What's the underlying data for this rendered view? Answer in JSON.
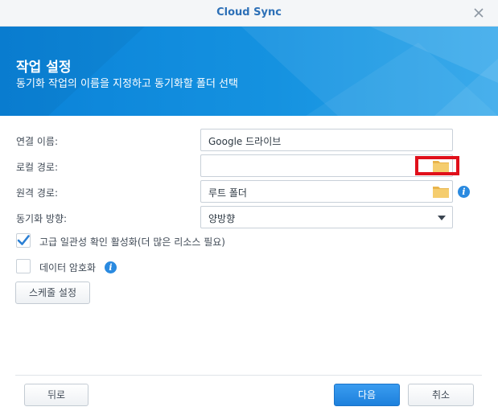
{
  "window": {
    "title": "Cloud Sync"
  },
  "banner": {
    "heading": "작업 설정",
    "subtitle": "동기화 작업의 이름을 지정하고 동기화할 폴더 선택"
  },
  "form": {
    "connection_name": {
      "label": "연결 이름:",
      "value": "Google 드라이브"
    },
    "local_path": {
      "label": "로컬 경로:",
      "value": ""
    },
    "remote_path": {
      "label": "원격 경로:",
      "value": "루트 폴더"
    },
    "sync_direction": {
      "label": "동기화 방향:",
      "value": "양방향"
    }
  },
  "options": {
    "advanced_consistency": {
      "label": "고급 일관성 확인 활성화(더 많은 리소스 필요)",
      "checked": true
    },
    "data_encryption": {
      "label": "데이터 암호화",
      "checked": false
    }
  },
  "buttons": {
    "schedule": "스케줄 설정",
    "back": "뒤로",
    "next": "다음",
    "cancel": "취소"
  },
  "icons": {
    "close": "close-icon",
    "folder": "folder-icon",
    "info": "info-icon",
    "check": "checkmark-icon",
    "dropdown": "chevron-down-icon"
  },
  "colors": {
    "title": "#2d70b7",
    "banner": "#0a82d8",
    "primary_button": "#1d80dc",
    "info_icon": "#2a8ae0",
    "folder_icon": "#f2c25c",
    "highlight_box": "#e0101b"
  }
}
